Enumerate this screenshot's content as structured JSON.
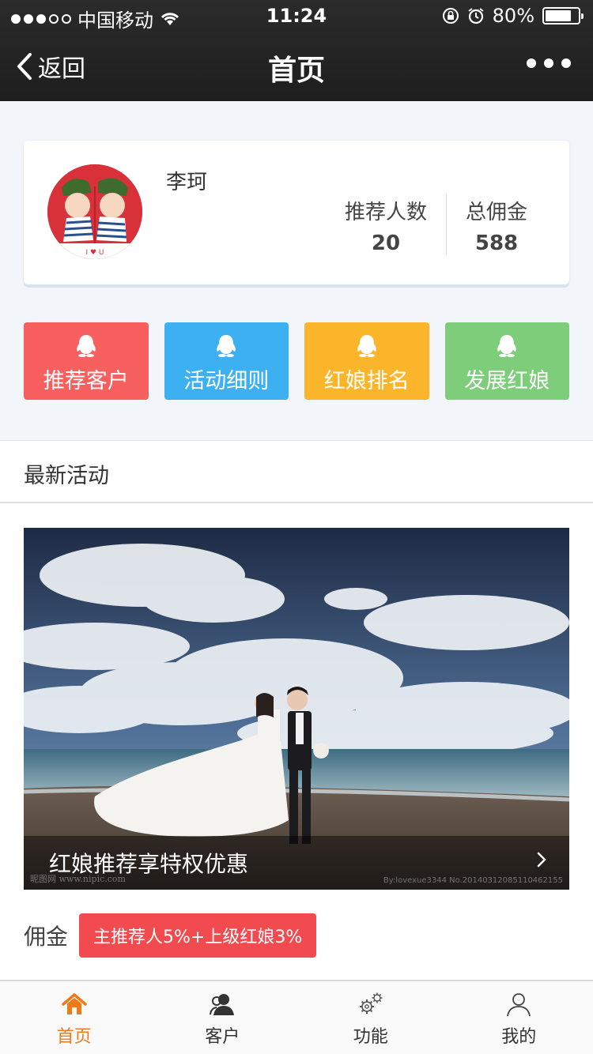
{
  "status_bar": {
    "carrier": "中国移动",
    "time": "11:24",
    "battery": "80%",
    "battery_level": 0.8
  },
  "nav": {
    "back_label": "返回",
    "title": "首页"
  },
  "profile": {
    "name": "李珂",
    "stats": [
      {
        "label": "推荐人数",
        "value": "20"
      },
      {
        "label": "总佣金",
        "value": "588"
      }
    ]
  },
  "actions": [
    {
      "label": "推荐客户",
      "color": "#f85f5f"
    },
    {
      "label": "活动细则",
      "color": "#3cb0f0"
    },
    {
      "label": "红娘排名",
      "color": "#fbb52a"
    },
    {
      "label": "发展红娘",
      "color": "#7dcd7b"
    }
  ],
  "section": {
    "title": "最新活动"
  },
  "banner": {
    "caption": "红娘推荐享特权优惠",
    "watermark_left": "昵图网 www.nipic.com",
    "watermark_right": "By:lovexue3344 No.20140312085110462155"
  },
  "commission": {
    "label": "佣金",
    "badge": "主推荐人5%+上级红娘3%"
  },
  "tabbar": [
    {
      "label": "首页",
      "icon": "home-icon",
      "active": true
    },
    {
      "label": "客户",
      "icon": "customer-icon",
      "active": false
    },
    {
      "label": "功能",
      "icon": "gears-icon",
      "active": false
    },
    {
      "label": "我的",
      "icon": "user-icon",
      "active": false
    }
  ],
  "colors": {
    "accent": "#f07a1a",
    "badge": "#f24b4f"
  }
}
